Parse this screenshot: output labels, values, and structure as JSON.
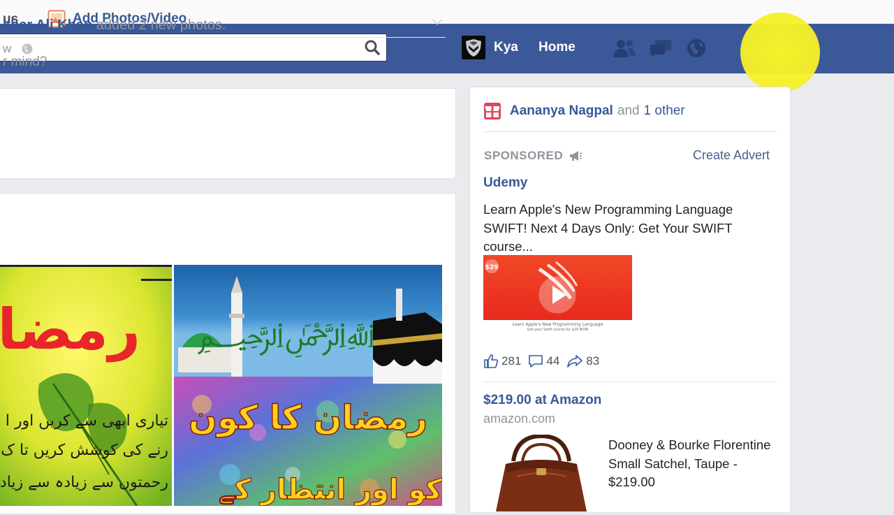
{
  "header": {
    "search": {
      "value": "",
      "placeholder": ""
    },
    "profile_name": "Kya",
    "home_label": "Home",
    "icons": [
      "friends-icon",
      "messages-icon",
      "notifications-globe-icon",
      "privacy-icon",
      "account-menu-icon"
    ]
  },
  "composer": {
    "status_label": "us",
    "add_media_label": "Add Photos/Video",
    "prompt": "r mind?"
  },
  "post": {
    "author": "kbar Ali Khan",
    "action": "added 2 new photos.",
    "time": "w",
    "photo1_text": "رمضان",
    "photo1_lines": [
      "تیاری ابھی سے کریں اور ا",
      "رنے کی کوشش کریں تا ک",
      "رحمتوں سے زیادہ سے زیادہ"
    ],
    "photo2_title": "رمضان کا کون",
    "photo2_bottom": "کو اور انتظار کے"
  },
  "sidebar": {
    "birthday": {
      "name": "Aananya Nagpal",
      "conj": "and",
      "other": "1 other"
    },
    "sponsored_label": "SPONSORED",
    "create_advert": "Create Advert",
    "ad1": {
      "title": "Udemy",
      "body": "Learn Apple's New Programming Language SWIFT! Next 4 Days Only: Get Your SWIFT course...",
      "price_badge": "$29",
      "image_caption_1": "Learn Apple's New Programming Language",
      "image_caption_2": "Get your Swift course for $29 NOW",
      "likes": "281",
      "comments": "44",
      "shares": "83"
    },
    "ad2": {
      "title": "$219.00 at Amazon",
      "domain": "amazon.com",
      "description": "Dooney & Bourke Florentine Small Satchel, Taupe - $219.00"
    }
  },
  "colors": {
    "brand_blue": "#3b5998",
    "link_blue": "#365899",
    "muted": "#90949c",
    "ad_red": "#ea2a1e",
    "cursor_highlight": "#f8f528"
  }
}
